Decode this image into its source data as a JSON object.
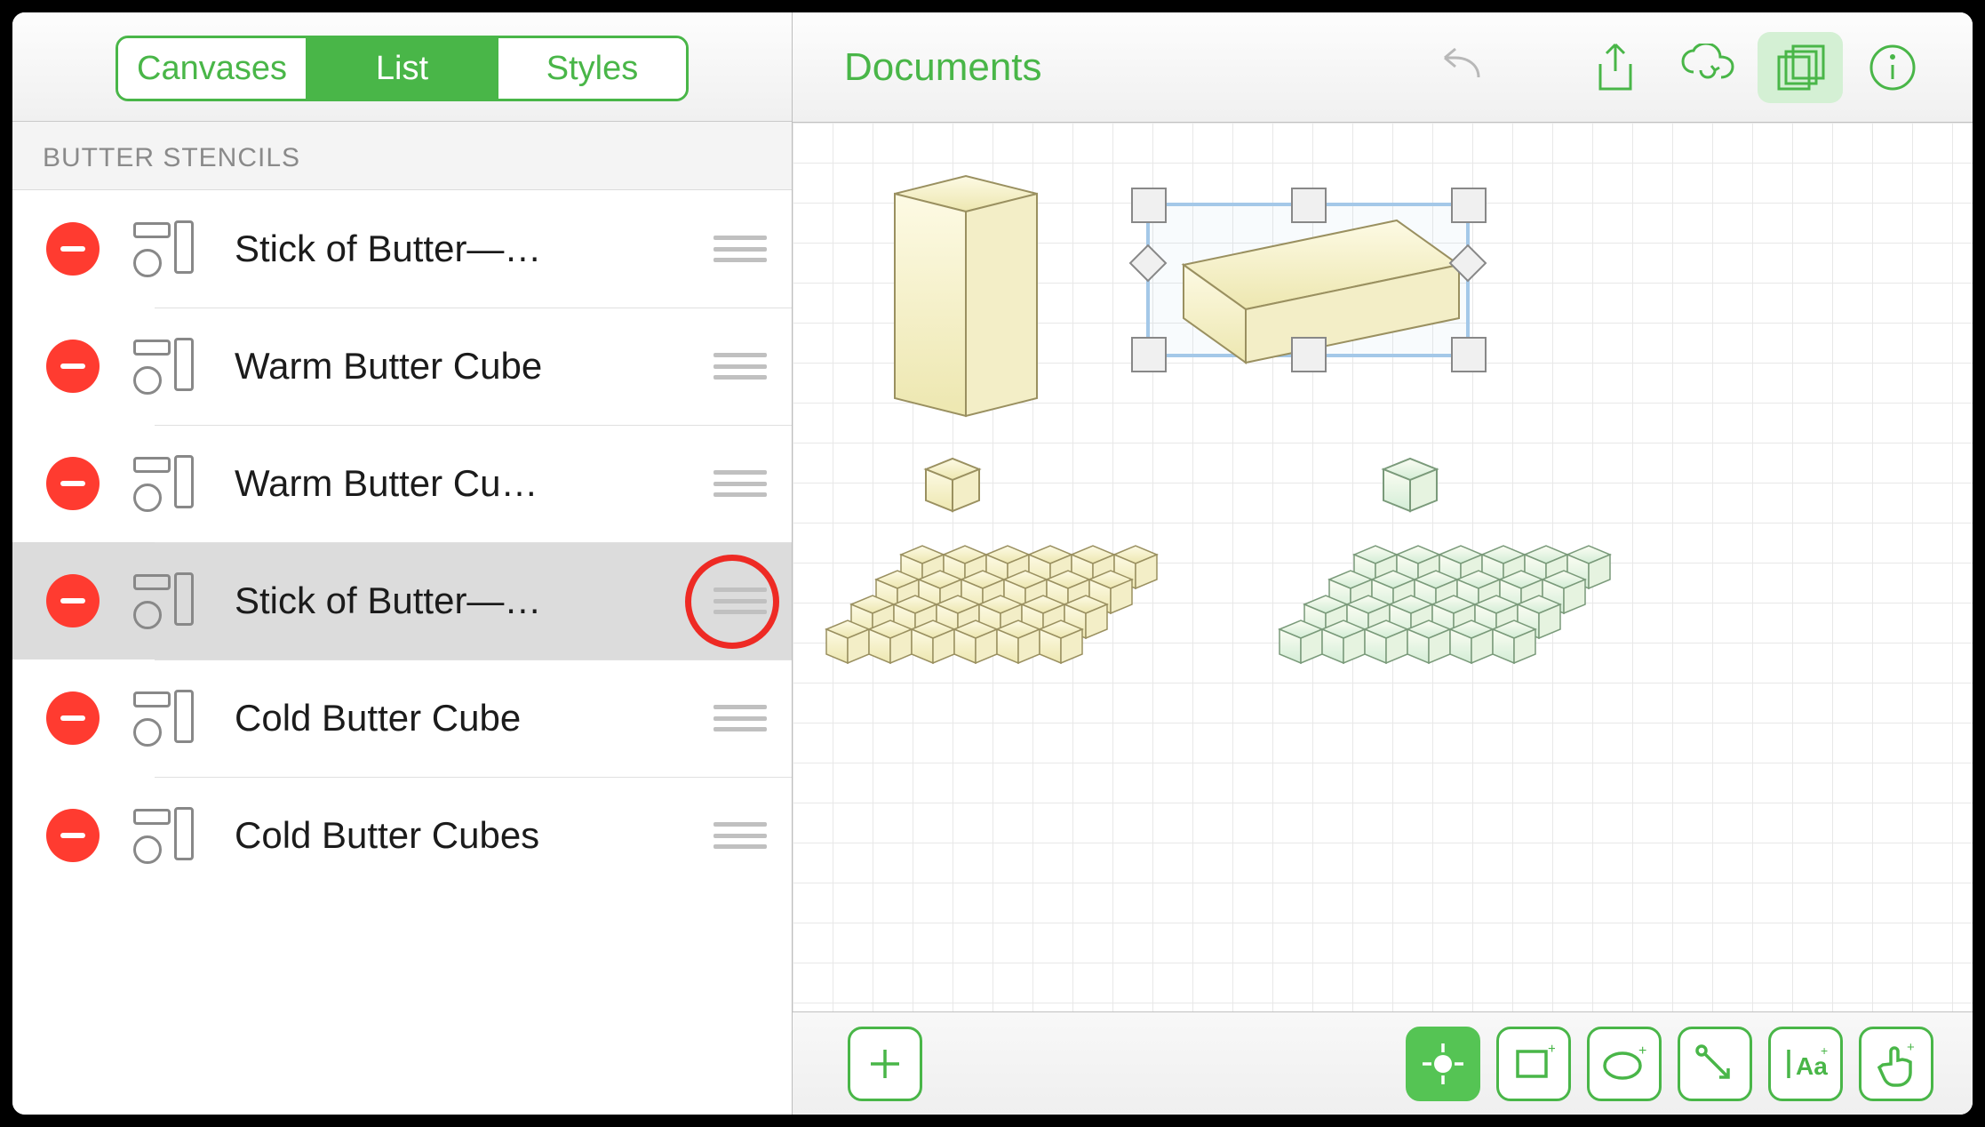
{
  "sidebar": {
    "tabs": {
      "canvases": "Canvases",
      "list": "List",
      "styles": "Styles"
    },
    "section_title": "BUTTER STENCILS",
    "items": [
      {
        "label": "Stick of Butter—…",
        "highlight": false,
        "ring": false
      },
      {
        "label": "Warm Butter Cube",
        "highlight": false,
        "ring": false
      },
      {
        "label": "Warm Butter Cu…",
        "highlight": false,
        "ring": false
      },
      {
        "label": "Stick of Butter—…",
        "highlight": true,
        "ring": true
      },
      {
        "label": "Cold Butter Cube",
        "highlight": false,
        "ring": false
      },
      {
        "label": "Cold Butter Cubes",
        "highlight": false,
        "ring": false
      }
    ]
  },
  "toolbar": {
    "documents": "Documents"
  },
  "bottom_tools": {
    "add": "add-shape",
    "target": "target",
    "rect": "rectangle",
    "ellipse": "ellipse",
    "line": "line",
    "text": "Aa",
    "touch": "touch"
  },
  "colors": {
    "accent": "#49b648",
    "delete": "#ff3b30",
    "ring": "#ee2a24"
  }
}
